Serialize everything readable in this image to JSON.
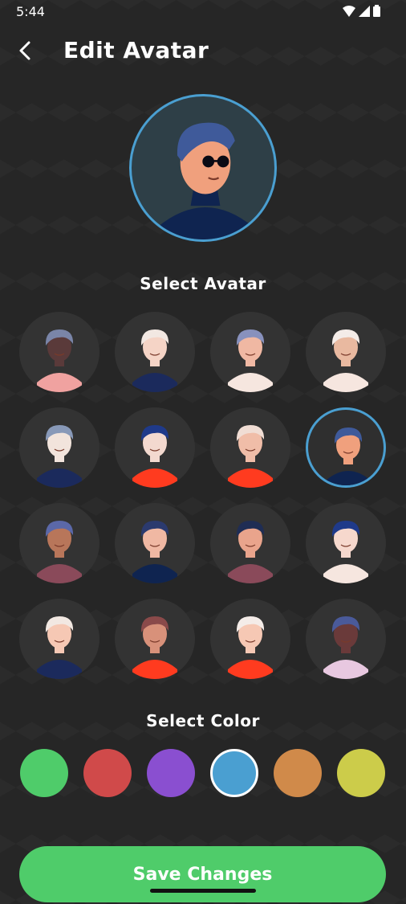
{
  "status": {
    "time": "5:44",
    "icons": [
      "wifi-icon",
      "signal-icon",
      "battery-icon"
    ]
  },
  "header": {
    "title": "Edit Avatar",
    "back_icon": "chevron-left-icon"
  },
  "preview": {
    "selected_avatar": "avatar-8",
    "ring_color": "#4a9fd1"
  },
  "avatar_section": {
    "title": "Select Avatar"
  },
  "avatars": [
    {
      "id": "avatar-1",
      "hair": "#7a85a8",
      "skin": "#5a3a3a",
      "shirt": "#f0a2a0"
    },
    {
      "id": "avatar-2",
      "hair": "#f2e8e2",
      "skin": "#f5d4c6",
      "shirt": "#1b2a5c"
    },
    {
      "id": "avatar-3",
      "hair": "#8891bd",
      "skin": "#f0b8a3",
      "shirt": "#f6e6df"
    },
    {
      "id": "avatar-4",
      "hair": "#f4ece8",
      "skin": "#e9b9a0",
      "shirt": "#f6e6df"
    },
    {
      "id": "avatar-5",
      "hair": "#8899b8",
      "skin": "#f2e4dc",
      "shirt": "#1b2a5c"
    },
    {
      "id": "avatar-6",
      "hair": "#1f3a8a",
      "skin": "#f3d9cf",
      "shirt": "#ff3b1f"
    },
    {
      "id": "avatar-7",
      "hair": "#f0ddd4",
      "skin": "#f0bda8",
      "shirt": "#ff3b1f"
    },
    {
      "id": "avatar-8",
      "hair": "#3f5a9a",
      "skin": "#f0a07d",
      "shirt": "#0f2450"
    },
    {
      "id": "avatar-9",
      "hair": "#5b68a8",
      "skin": "#b8765a",
      "shirt": "#8a4a5a"
    },
    {
      "id": "avatar-10",
      "hair": "#2b3a6e",
      "skin": "#f0b8a3",
      "shirt": "#0f2450"
    },
    {
      "id": "avatar-11",
      "hair": "#1f2d54",
      "skin": "#e9a48c",
      "shirt": "#8a4a5a"
    },
    {
      "id": "avatar-12",
      "hair": "#1f3a8a",
      "skin": "#f6d8cd",
      "shirt": "#f6e6df"
    },
    {
      "id": "avatar-13",
      "hair": "#f2e8e2",
      "skin": "#f6c8b4",
      "shirt": "#1b2a5c"
    },
    {
      "id": "avatar-14",
      "hair": "#8a4a4a",
      "skin": "#d8917a",
      "shirt": "#ff3b1f"
    },
    {
      "id": "avatar-15",
      "hair": "#f4ece8",
      "skin": "#f6c8b4",
      "shirt": "#ff3b1f"
    },
    {
      "id": "avatar-16",
      "hair": "#4a5a9a",
      "skin": "#6a3a3a",
      "shirt": "#e8c8e0"
    }
  ],
  "color_section": {
    "title": "Select Color"
  },
  "colors": [
    {
      "id": "green",
      "hex": "#4fcc6a"
    },
    {
      "id": "red",
      "hex": "#d04a4a"
    },
    {
      "id": "purple",
      "hex": "#8a4fd0"
    },
    {
      "id": "blue",
      "hex": "#4a9fd1",
      "selected": true
    },
    {
      "id": "orange",
      "hex": "#d08a4a"
    },
    {
      "id": "yellow",
      "hex": "#cccc4a"
    }
  ],
  "save_button": {
    "label": "Save Changes",
    "color": "#4fcc6a"
  }
}
